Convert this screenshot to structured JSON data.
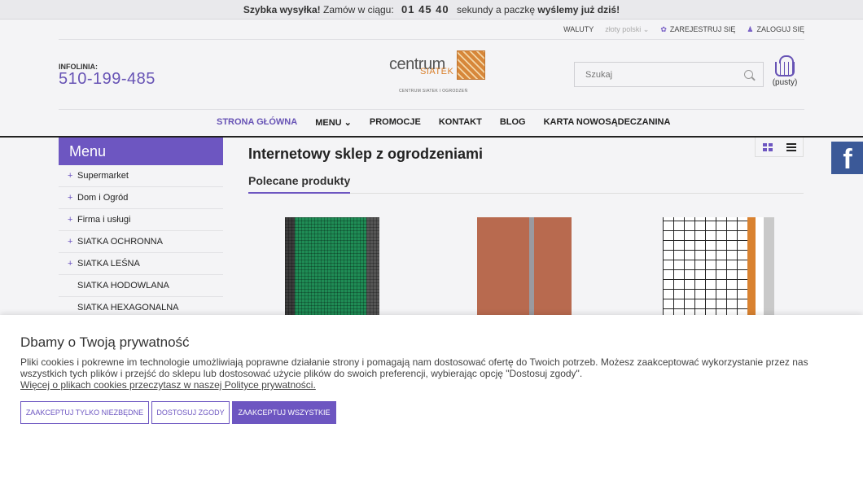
{
  "promo": {
    "lead": "Szybka wysyłka!",
    "text1": "Zamów w ciągu:",
    "timer": "01 45 40",
    "text2": "sekundy  a paczkę",
    "tail": "wyślemy już dziś!"
  },
  "utility": {
    "currency_label": "WALUTY",
    "currency_value": "złoty polski ⌄",
    "register": "ZAREJESTRUJ SIĘ",
    "login": "ZALOGUJ SIĘ"
  },
  "header": {
    "hotline_label": "INFOLINIA:",
    "hotline_phone": "510-199-485",
    "logo_word1": "centrum",
    "logo_word2": "SIATEK",
    "logo_sub": "CENTRUM SIATEK I OGRODZEŃ",
    "search_placeholder": "Szukaj",
    "cart_label": "(pusty)"
  },
  "nav": {
    "items": [
      "STRONA GŁÓWNA",
      "MENU ⌄",
      "PROMOCJE",
      "KONTAKT",
      "BLOG",
      "KARTA NOWOSĄDECZANINA"
    ]
  },
  "sidebar": {
    "title": "Menu",
    "items": [
      {
        "label": "Supermarket",
        "plus": "+"
      },
      {
        "label": "Dom i Ogród",
        "plus": "+"
      },
      {
        "label": "Firma i usługi",
        "plus": "+"
      },
      {
        "label": "SIATKA OCHRONNA",
        "plus": "+"
      },
      {
        "label": "SIATKA LEŚNA",
        "plus": "+"
      },
      {
        "label": "SIATKA HODOWLANA",
        "plus": ""
      },
      {
        "label": "SIATKA HEXAGONALNA",
        "plus": ""
      }
    ]
  },
  "main": {
    "title": "Internetowy sklep z ogrodzeniami",
    "section": "Polecane produkty"
  },
  "social": {
    "facebook": "f"
  },
  "cookie": {
    "title": "Dbamy o Twoją prywatność",
    "text": "Pliki cookies i pokrewne im technologie umożliwiają poprawne działanie strony i pomagają nam dostosować ofertę do Twoich potrzeb. Możesz zaakceptować wykorzystanie przez nas wszystkich tych plików i przejść do sklepu lub dostosować użycie plików do swoich preferencji, wybierając opcję \"Dostosuj zgody\".",
    "link": "Więcej o plikach cookies przeczytasz w naszej Polityce prywatności.",
    "btn_necessary": "ZAAKCEPTUJ TYLKO NIEZBĘDNE",
    "btn_customize": "DOSTOSUJ ZGODY",
    "btn_accept_all": "ZAAKCEPTUJ WSZYSTKIE"
  },
  "colors": {
    "accent": "#6d56c1",
    "facebook": "#3b5998"
  }
}
